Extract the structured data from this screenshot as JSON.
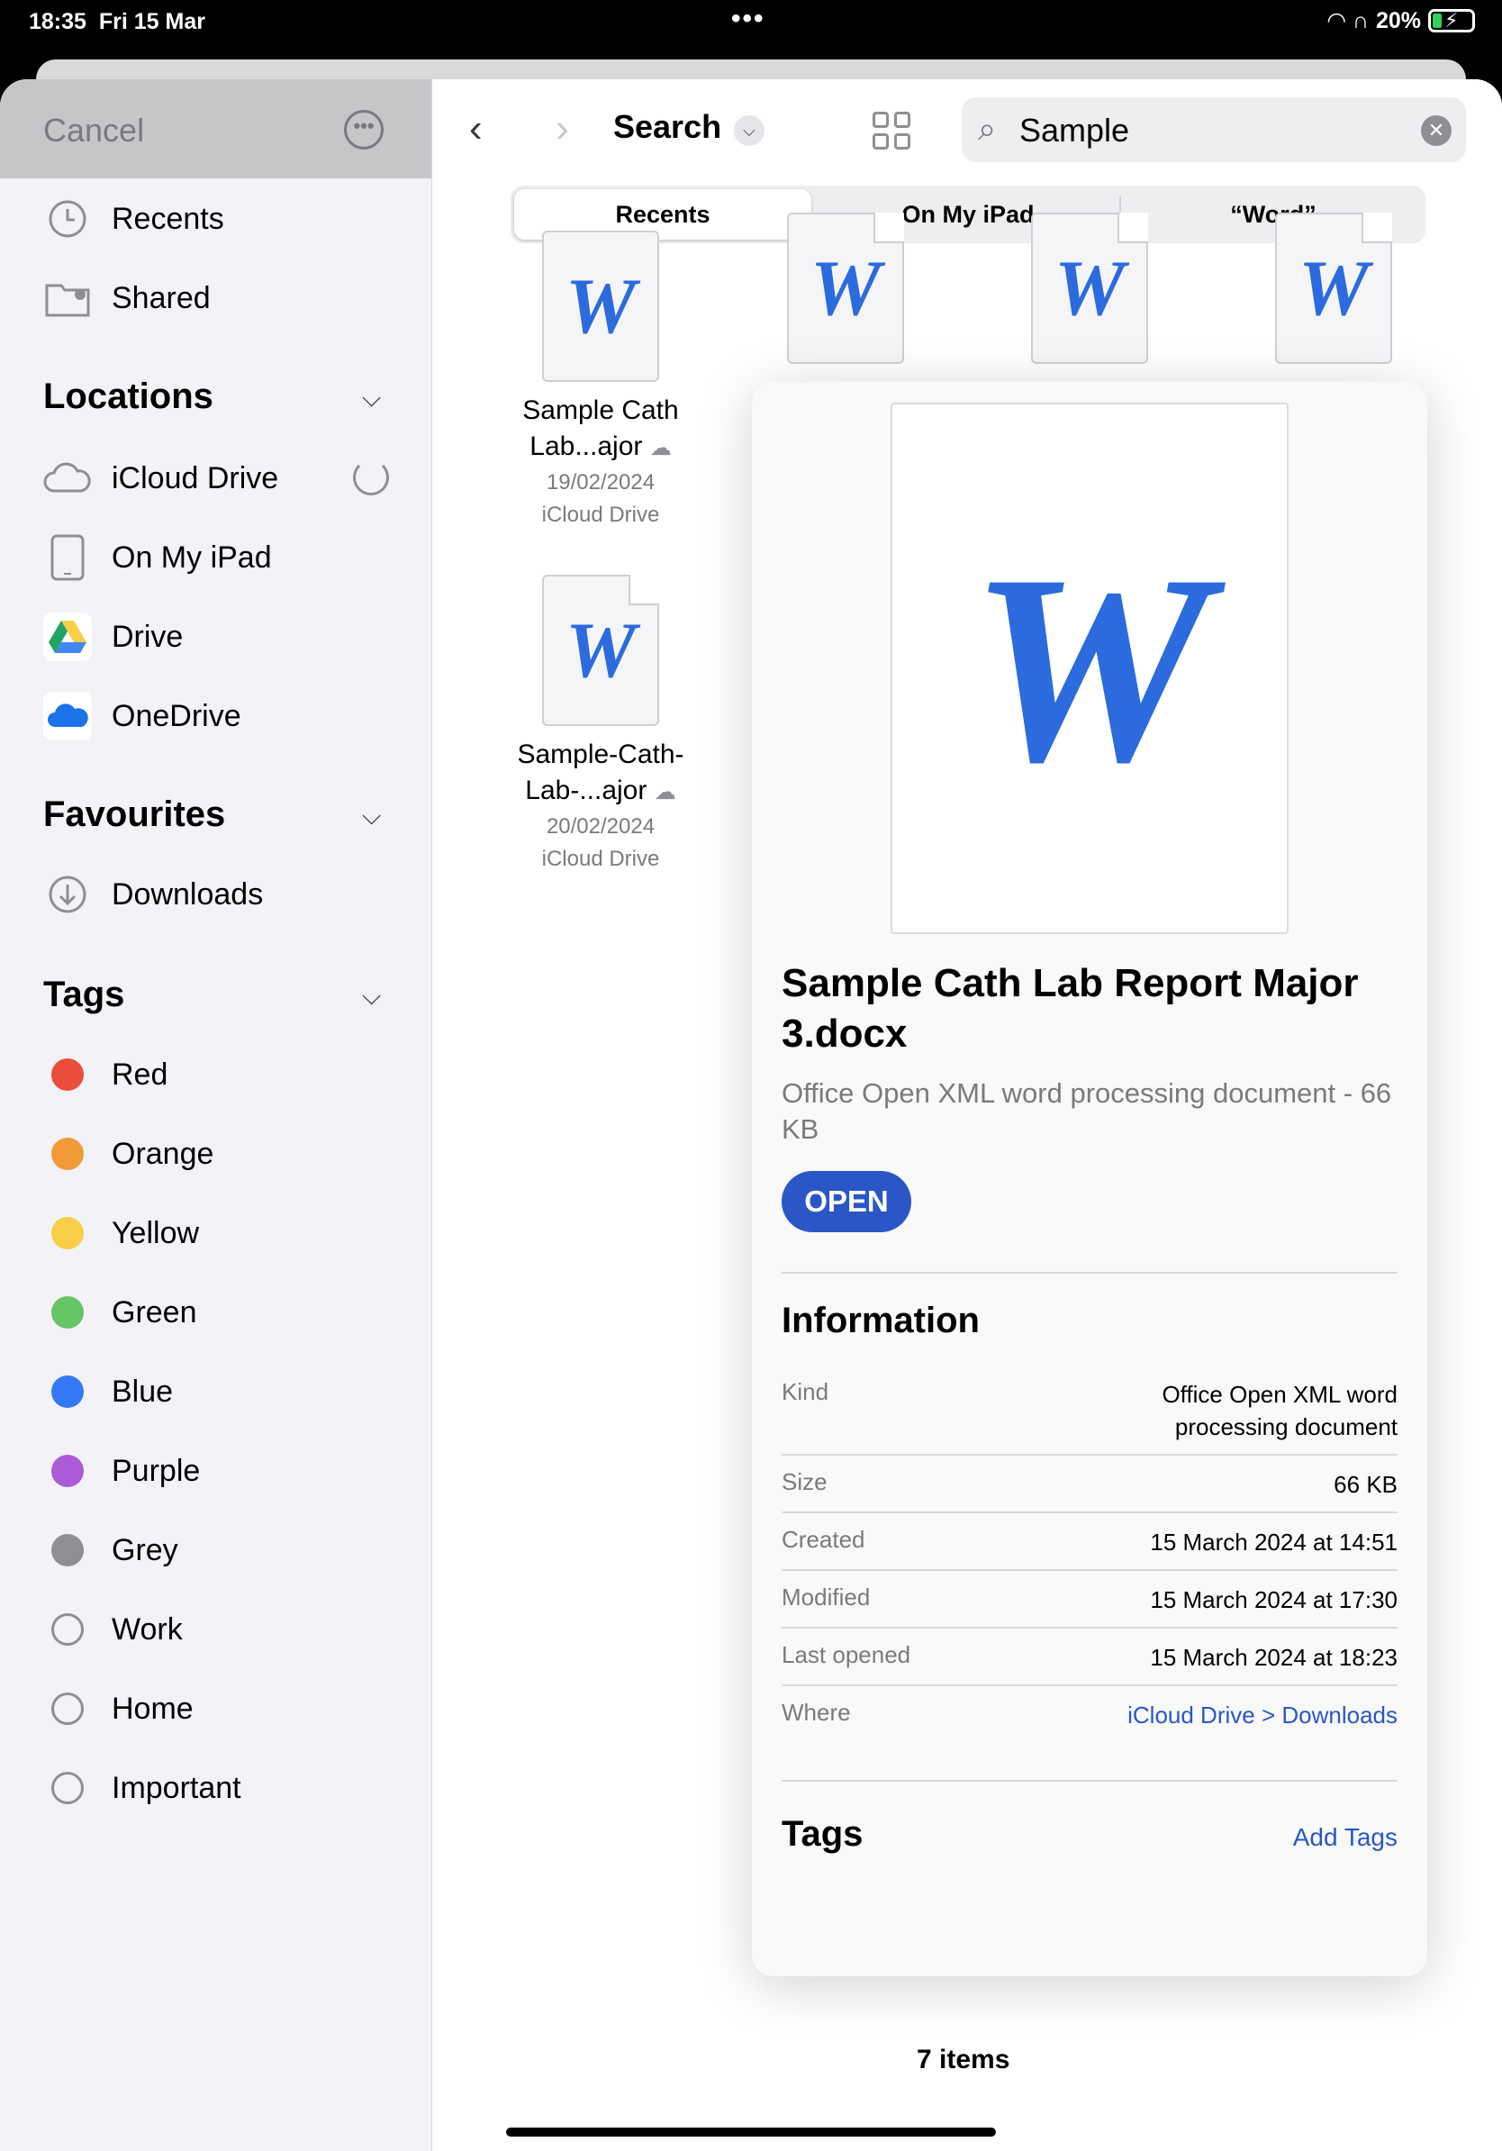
{
  "status": {
    "time": "18:35",
    "date": "Fri 15 Mar",
    "battery": "20%"
  },
  "sidebar": {
    "cancel": "Cancel",
    "top_items": [
      {
        "label": "Recents",
        "icon": "clock-icon"
      },
      {
        "label": "Shared",
        "icon": "shared-folder-icon"
      }
    ],
    "locations_header": "Locations",
    "locations": [
      {
        "label": "iCloud Drive",
        "icon": "cloud-icon"
      },
      {
        "label": "On My iPad",
        "icon": "ipad-icon"
      },
      {
        "label": "Drive",
        "icon": "google-drive-icon"
      },
      {
        "label": "OneDrive",
        "icon": "onedrive-icon"
      }
    ],
    "favourites_header": "Favourites",
    "favourites": [
      {
        "label": "Downloads",
        "icon": "download-icon"
      }
    ],
    "tags_header": "Tags",
    "tags": [
      {
        "label": "Red",
        "color": "#eb4d3d"
      },
      {
        "label": "Orange",
        "color": "#f19a37"
      },
      {
        "label": "Yellow",
        "color": "#f7ce46"
      },
      {
        "label": "Green",
        "color": "#65c466"
      },
      {
        "label": "Blue",
        "color": "#3478f6"
      },
      {
        "label": "Purple",
        "color": "#ac5bd6"
      },
      {
        "label": "Grey",
        "color": "#8e8e93"
      },
      {
        "label": "Work",
        "color": ""
      },
      {
        "label": "Home",
        "color": ""
      },
      {
        "label": "Important",
        "color": ""
      }
    ]
  },
  "main": {
    "title": "Search",
    "search_value": "Sample",
    "scopes": [
      "Recents",
      "On My iPad",
      "“Word”"
    ],
    "files": [
      {
        "name_line1": "Sample Cath",
        "name_line2": "Lab...ajor",
        "date": "19/02/2024",
        "location": "iCloud Drive"
      },
      {
        "name_line1": "Sample-Cath-",
        "name_line2": "Lab-...ajor",
        "date": "20/02/2024",
        "location": "iCloud Drive"
      }
    ],
    "item_count": "7 items"
  },
  "popover": {
    "title": "Sample Cath Lab Report Major 3.docx",
    "subtitle": "Office Open XML word processing document - 66 KB",
    "open_label": "OPEN",
    "info_header": "Information",
    "info": [
      {
        "key": "Kind",
        "value": "Office Open XML word processing document"
      },
      {
        "key": "Size",
        "value": "66 KB"
      },
      {
        "key": "Created",
        "value": "15 March 2024 at 14:51"
      },
      {
        "key": "Modified",
        "value": "15 March 2024 at 17:30"
      },
      {
        "key": "Last opened",
        "value": "15 March 2024 at 18:23"
      },
      {
        "key": "Where",
        "value": "iCloud Drive > Downloads"
      }
    ],
    "tags_header": "Tags",
    "add_tags": "Add Tags"
  }
}
